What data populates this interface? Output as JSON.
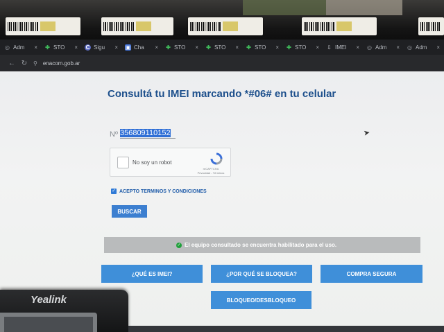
{
  "browser": {
    "tabs": [
      {
        "icon": "globe-icon",
        "label": "Adm"
      },
      {
        "icon": "sto-icon",
        "label": "STO"
      },
      {
        "icon": "c-icon",
        "label": "Sigu"
      },
      {
        "icon": "chat-icon",
        "label": "Cha"
      },
      {
        "icon": "sto-icon",
        "label": "STO"
      },
      {
        "icon": "sto-icon",
        "label": "STO"
      },
      {
        "icon": "sto-icon",
        "label": "STO"
      },
      {
        "icon": "sto-icon",
        "label": "STO"
      },
      {
        "icon": "imei-icon",
        "label": "IMEI"
      },
      {
        "icon": "globe-icon",
        "label": "Adm"
      },
      {
        "icon": "globe-icon",
        "label": "Adm"
      }
    ],
    "url": "enacom.gob.ar"
  },
  "page": {
    "title": "Consultá tu IMEI marcando *#06# en tu celular",
    "imei_prefix": "Nº",
    "imei_value": "356809110152",
    "captcha": {
      "label": "No soy un robot",
      "brand": "reCAPTCHA",
      "links": "Privacidad - Términos"
    },
    "terms_label": "ACEPTO TERMINOS Y CONDICIONES",
    "terms_checked": true,
    "search_button": "BUSCAR",
    "status_message": "El equipo consultado se encuentra habilitado para el uso.",
    "buttons": {
      "what_is_imei": "¿QUÉ ES IMEI?",
      "why_blocked": "¿POR QUÉ SE BLOQUEA?",
      "safe_purchase": "COMPRA SEGURA",
      "block_unblock": "BLOQUEO/DESBLOQUEO"
    }
  },
  "phone": {
    "brand": "Yealink"
  },
  "colors": {
    "title": "#1d4f8c",
    "button": "#3f8fd9",
    "status_bg": "#b9bbbc",
    "success": "#1fa03a"
  }
}
